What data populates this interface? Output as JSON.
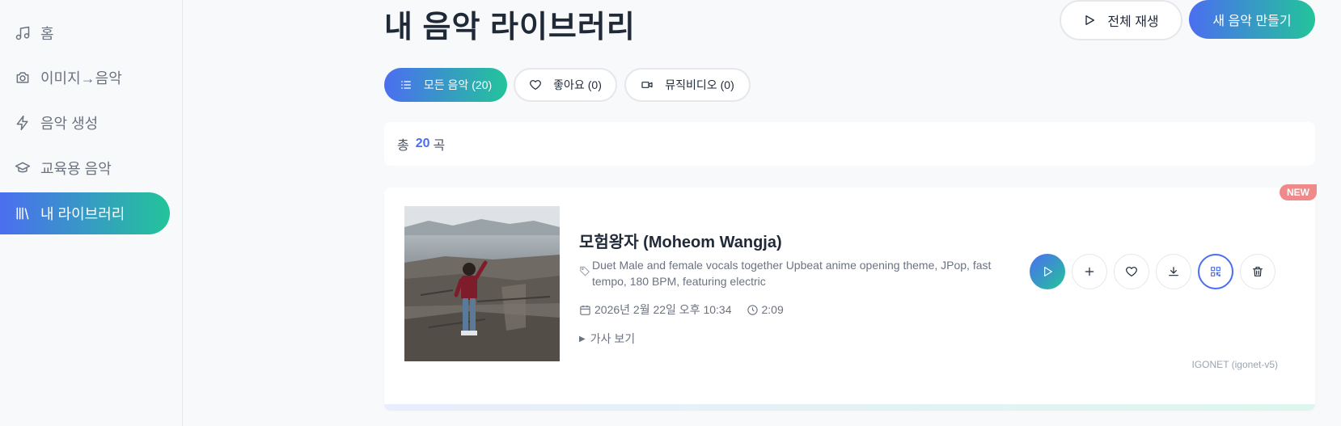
{
  "sidebar": {
    "items": [
      {
        "label": "홈",
        "icon": "music-note-icon"
      },
      {
        "label": "이미지→음악",
        "icon": "camera-icon"
      },
      {
        "label": "음악 생성",
        "icon": "lightning-icon"
      },
      {
        "label": "교육용 음악",
        "icon": "graduation-cap-icon"
      },
      {
        "label": "내 라이브러리",
        "icon": "library-icon",
        "active": true
      }
    ]
  },
  "header": {
    "title": "내 음악 라이브러리",
    "play_all_label": "전체 재생",
    "new_music_label": "새 음악 만들기"
  },
  "tabs": [
    {
      "label": "모든 음악",
      "count": "(20)",
      "icon": "list-icon",
      "active": true
    },
    {
      "label": "좋아요",
      "count": "(0)",
      "icon": "heart-icon"
    },
    {
      "label": "뮤직비디오",
      "count": "(0)",
      "icon": "video-icon"
    }
  ],
  "summary": {
    "prefix": "총",
    "count": "20",
    "suffix": "곡"
  },
  "song": {
    "badge": "NEW",
    "title": "모험왕자 (Moheom Wangja)",
    "description": "Duet Male and female vocals together Upbeat anime opening theme, JPop, fast tempo, 180 BPM, featuring electric",
    "date": "2026년 2월 22일 오후 10:34",
    "duration": "2:09",
    "lyrics_toggle": "가사 보기",
    "model": "IGONET (igonet-v5)"
  },
  "colors": {
    "accent_start": "#4b6ef0",
    "accent_end": "#23c49a",
    "new_badge": "#f08a8a"
  }
}
